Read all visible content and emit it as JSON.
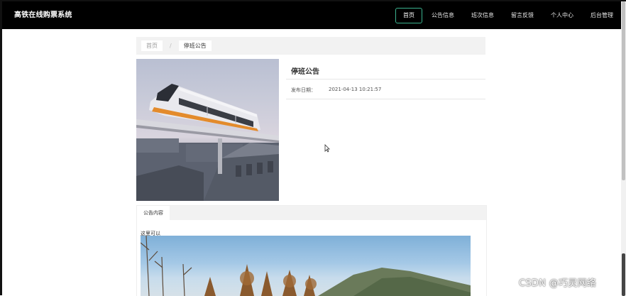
{
  "header": {
    "brand": "高铁在线购票系统",
    "nav": [
      {
        "label": "首页",
        "active": true
      },
      {
        "label": "公告信息",
        "active": false
      },
      {
        "label": "班次信息",
        "active": false
      },
      {
        "label": "留言反馈",
        "active": false
      },
      {
        "label": "个人中心",
        "active": false
      },
      {
        "label": "后台管理",
        "active": false
      }
    ]
  },
  "breadcrumb": {
    "home": "首页",
    "separator": "/",
    "current": "停班公告"
  },
  "detail": {
    "title": "停班公告",
    "date_label": "发布日期：",
    "date_value": "2021-04-13 10:21:57"
  },
  "tabs": {
    "active_tab": "公告内容",
    "content_text": "这里可以"
  },
  "watermark": "CSDN @巧灵网络",
  "colors": {
    "topbar": "#000000",
    "nav_active_border": "#3bb38f",
    "breadcrumb_bg": "#f2f2f2"
  }
}
